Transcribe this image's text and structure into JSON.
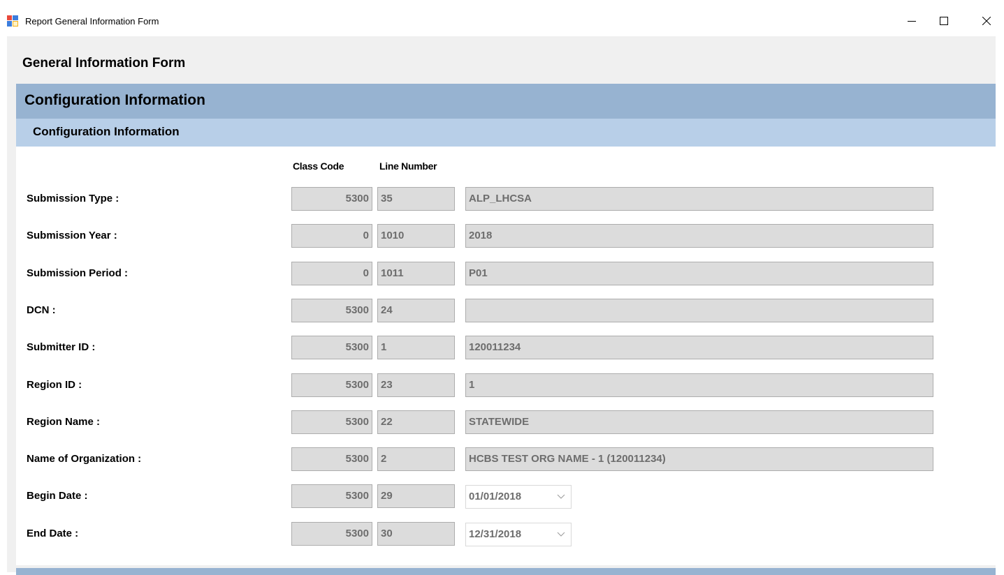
{
  "window": {
    "title": "Report General Information Form"
  },
  "form": {
    "title": "General Information Form",
    "section_title": "Configuration Information",
    "subsection_title": "Configuration Information",
    "headers": {
      "class_code": "Class Code",
      "line_number": "Line Number"
    },
    "rows": [
      {
        "label": "Submission Type :",
        "class_code": "5300",
        "line_number": "35",
        "value": "ALP_LHCSA",
        "kind": "text"
      },
      {
        "label": "Submission Year :",
        "class_code": "0",
        "line_number": "1010",
        "value": "2018",
        "kind": "text"
      },
      {
        "label": "Submission Period :",
        "class_code": "0",
        "line_number": "1011",
        "value": "P01",
        "kind": "text"
      },
      {
        "label": "DCN :",
        "class_code": "5300",
        "line_number": "24",
        "value": "",
        "kind": "text"
      },
      {
        "label": "Submitter ID :",
        "class_code": "5300",
        "line_number": "1",
        "value": "120011234",
        "kind": "text"
      },
      {
        "label": "Region ID :",
        "class_code": "5300",
        "line_number": "23",
        "value": "1",
        "kind": "text"
      },
      {
        "label": "Region Name :",
        "class_code": "5300",
        "line_number": "22",
        "value": "STATEWIDE",
        "kind": "text"
      },
      {
        "label": "Name of Organization :",
        "class_code": "5300",
        "line_number": "2",
        "value": "HCBS TEST ORG NAME - 1 (120011234)",
        "kind": "text"
      },
      {
        "label": "Begin Date :",
        "class_code": "5300",
        "line_number": "29",
        "value": "01/01/2018",
        "kind": "date"
      },
      {
        "label": "End Date :",
        "class_code": "5300",
        "line_number": "30",
        "value": "12/31/2018",
        "kind": "date"
      }
    ]
  },
  "colors": {
    "section_band": "#97b3d1",
    "subsection_band": "#b8cfe8",
    "readonly_field": "#dcdcdc",
    "readonly_text": "#6d6d6d"
  },
  "icons": {
    "app": "app-form-icon",
    "minimize": "minimize-icon",
    "maximize": "maximize-icon",
    "close": "close-icon",
    "dropdown": "chevron-down-icon"
  }
}
